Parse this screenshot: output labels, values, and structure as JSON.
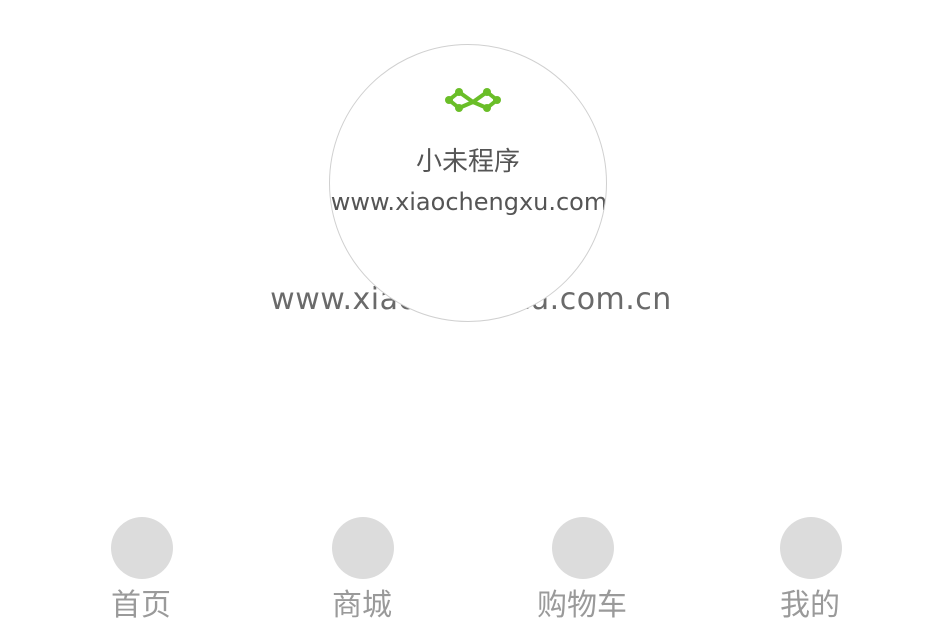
{
  "watermark_url": "www.xiaochengxu.com.cn",
  "brand": {
    "logo_icon": "molecule-logo-icon",
    "logo_color": "#6abe28",
    "name": "小未程序",
    "url": "www.xiaochengxu.com"
  },
  "tabbar": {
    "items": [
      {
        "label": "首页",
        "icon": "home-icon"
      },
      {
        "label": "商城",
        "icon": "shop-icon"
      },
      {
        "label": "购物车",
        "icon": "cart-icon"
      },
      {
        "label": "我的",
        "icon": "profile-icon"
      }
    ]
  }
}
